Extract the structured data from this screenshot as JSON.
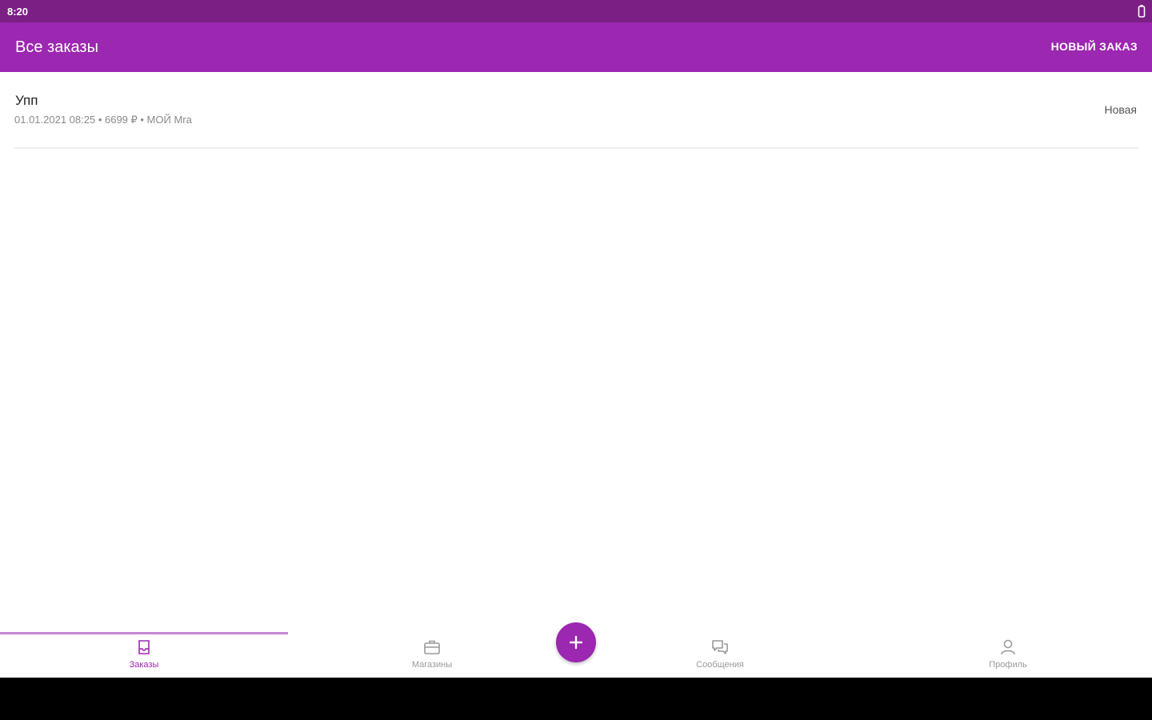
{
  "status_bar": {
    "time": "8:20",
    "battery_icon": "battery-icon"
  },
  "app_bar": {
    "title": "Все заказы",
    "action_label": "НОВЫЙ ЗАКАЗ"
  },
  "orders": [
    {
      "title": "Упп",
      "meta": "01.01.2021 08:25 • 6699 ₽ • МОЙ Mra",
      "status": "Новая"
    }
  ],
  "bottom_nav": {
    "items": [
      {
        "label": "Заказы",
        "icon": "inbox-icon",
        "active": true
      },
      {
        "label": "Магазины",
        "icon": "briefcase-icon",
        "active": false
      },
      {
        "label": "Сообщения",
        "icon": "chat-icon",
        "active": false
      },
      {
        "label": "Профиль",
        "icon": "person-icon",
        "active": false
      }
    ],
    "fab_icon": "plus-icon"
  },
  "colors": {
    "primary": "#9c27b0",
    "primary_dark": "#7b1f85",
    "indicator": "#c687d3",
    "inactive": "#9a9a9a"
  }
}
